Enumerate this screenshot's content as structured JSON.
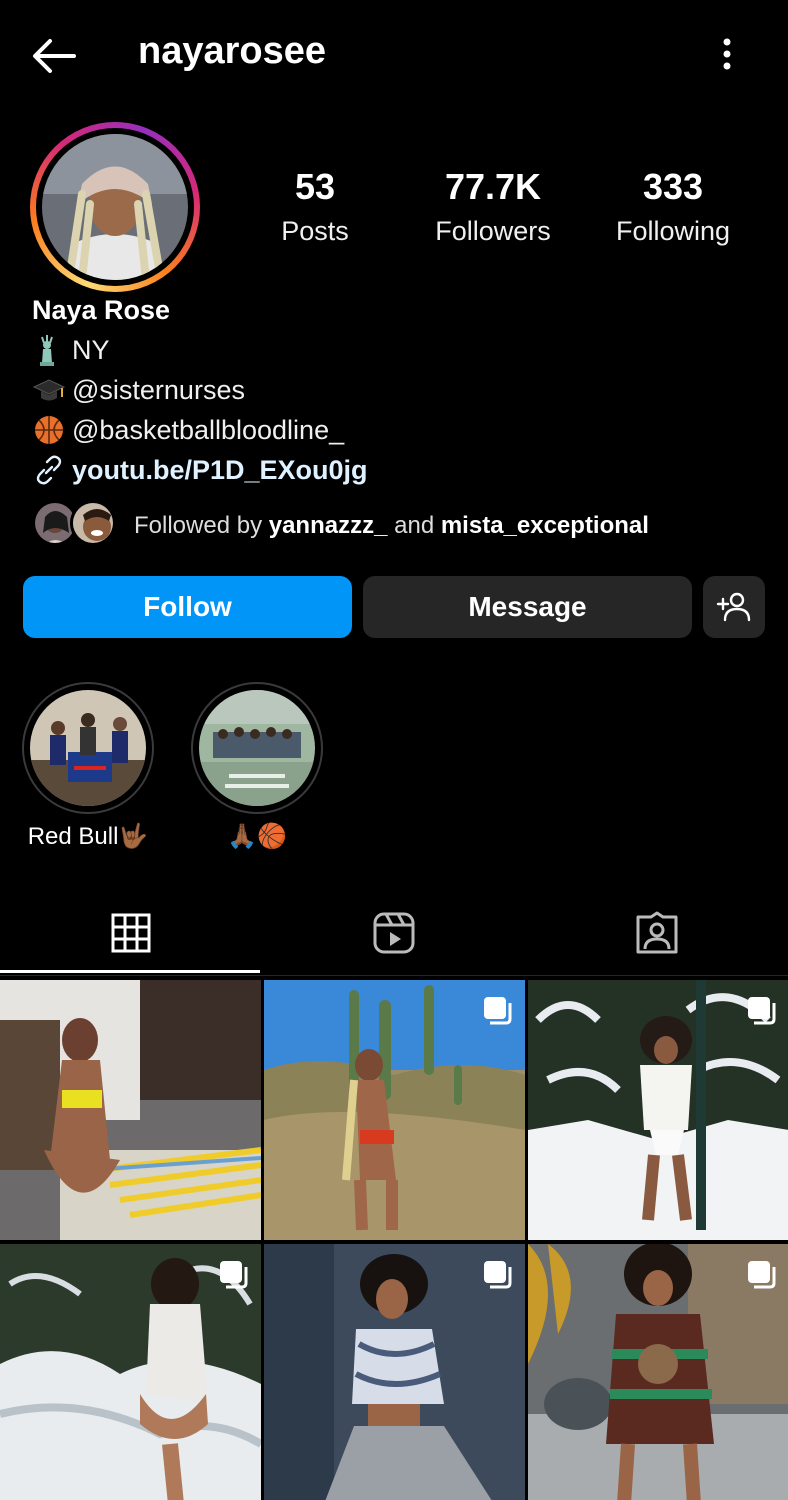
{
  "header": {
    "username": "nayarosee"
  },
  "stats": [
    {
      "value": "53",
      "label": "Posts"
    },
    {
      "value": "77.7K",
      "label": "Followers"
    },
    {
      "value": "333",
      "label": "Following"
    }
  ],
  "bio": {
    "name": "Naya Rose",
    "lines": [
      {
        "emoji": "statue-of-liberty-icon",
        "text": "NY"
      },
      {
        "emoji": "graduation-cap-icon",
        "text": "@sisternurses"
      },
      {
        "emoji": "basketball-icon",
        "text": "@basketballbloodline_"
      }
    ],
    "link": "youtu.be/P1D_EXou0jg"
  },
  "followed_by": {
    "prefix": "Followed by",
    "user1": "yannazzz_",
    "joiner": "and",
    "user2": "mista_exceptional"
  },
  "buttons": {
    "follow": "Follow",
    "message": "Message"
  },
  "highlights": [
    {
      "caption": "Red Bull🤟🏾"
    },
    {
      "caption": "🙏🏾🏀"
    }
  ],
  "colors": {
    "accent": "#0095f6",
    "surface": "#262626",
    "background": "#000000"
  }
}
